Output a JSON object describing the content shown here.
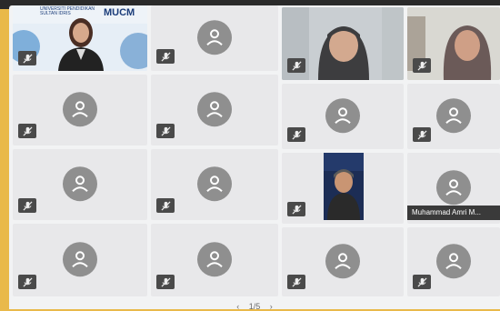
{
  "meeting": {
    "banner_logo": "MUCM",
    "banner_text": "UNIVERSITI PENDIDIKAN SULTAN IDRIS",
    "tiles": [
      {
        "type": "video",
        "person": "female-presenter"
      },
      {
        "type": "avatar"
      },
      {
        "type": "video",
        "person": "female-hijab-1"
      },
      {
        "type": "video",
        "person": "female-hijab-2"
      },
      {
        "type": "avatar"
      },
      {
        "type": "avatar"
      },
      {
        "type": "avatar"
      },
      {
        "type": "avatar"
      },
      {
        "type": "avatar"
      },
      {
        "type": "avatar"
      },
      {
        "type": "video",
        "person": "male-cap"
      },
      {
        "type": "avatar",
        "name": "Muhammad Amri M..."
      },
      {
        "type": "avatar"
      },
      {
        "type": "avatar"
      },
      {
        "type": "avatar"
      },
      {
        "type": "avatar"
      }
    ],
    "pagination": {
      "prev": "‹",
      "label": "1/5",
      "next": "›"
    }
  },
  "colors": {
    "frame": "#e9b94a",
    "tile": "#e8e8ea",
    "avatar": "#8f8f8f"
  },
  "icons": {
    "mic_muted": "mic-muted-icon",
    "avatar": "user-avatar-icon"
  }
}
